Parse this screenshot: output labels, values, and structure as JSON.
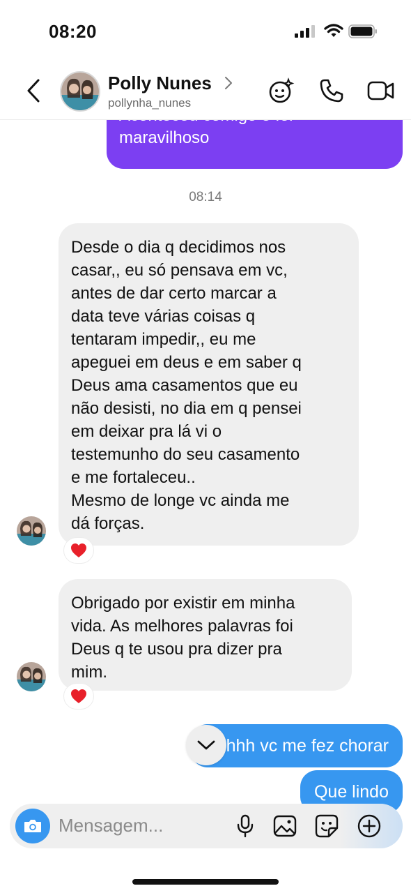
{
  "status_bar": {
    "time": "08:20"
  },
  "header": {
    "contact_name": "Polly Nunes",
    "username": "pollynha_nunes",
    "icons": [
      "back-icon",
      "avatar",
      "chevron-right-icon",
      "effects-icon",
      "phone-icon",
      "video-call-icon"
    ]
  },
  "messages": [
    {
      "id": "m1",
      "direction": "outgoing",
      "style": "purple",
      "lines": [
        "Aconteceu comigo e foi",
        "maravilhoso"
      ]
    },
    {
      "id": "ts1",
      "type": "timestamp",
      "text": "08:14"
    },
    {
      "id": "m2",
      "direction": "incoming",
      "lines": [
        "Desde o dia q decidimos nos",
        "casar,, eu só pensava em vc,",
        "antes de dar certo marcar a",
        "data teve várias coisas q",
        "tentaram impedir,, eu me",
        "apeguei em deus e em saber q",
        "Deus ama casamentos que eu",
        "não desisti, no dia em q pensei",
        "em deixar pra lá vi o",
        "testemunho do seu casamento",
        "e me fortaleceu..",
        "Mesmo de longe vc ainda me",
        "dá forças."
      ],
      "reaction": "❤️"
    },
    {
      "id": "m3",
      "direction": "incoming",
      "lines": [
        "Obrigado por existir em minha",
        "vida. As melhores palavras foi",
        "Deus q te usou pra dizer pra",
        "mim."
      ],
      "reaction": "❤️"
    },
    {
      "id": "m4",
      "direction": "outgoing",
      "text": "Ahhhh vc me fez chorar"
    },
    {
      "id": "m5",
      "direction": "outgoing",
      "text": "Que lindo"
    }
  ],
  "composer": {
    "placeholder": "Mensagem...",
    "icons": [
      "camera-icon",
      "microphone-icon",
      "gallery-icon",
      "sticker-icon",
      "plus-icon"
    ]
  },
  "colors": {
    "outgoing_blue": "#3797f0",
    "outgoing_purple": "#7c3ff2",
    "incoming_gray": "#efefef",
    "reaction_red": "#e8202a"
  }
}
